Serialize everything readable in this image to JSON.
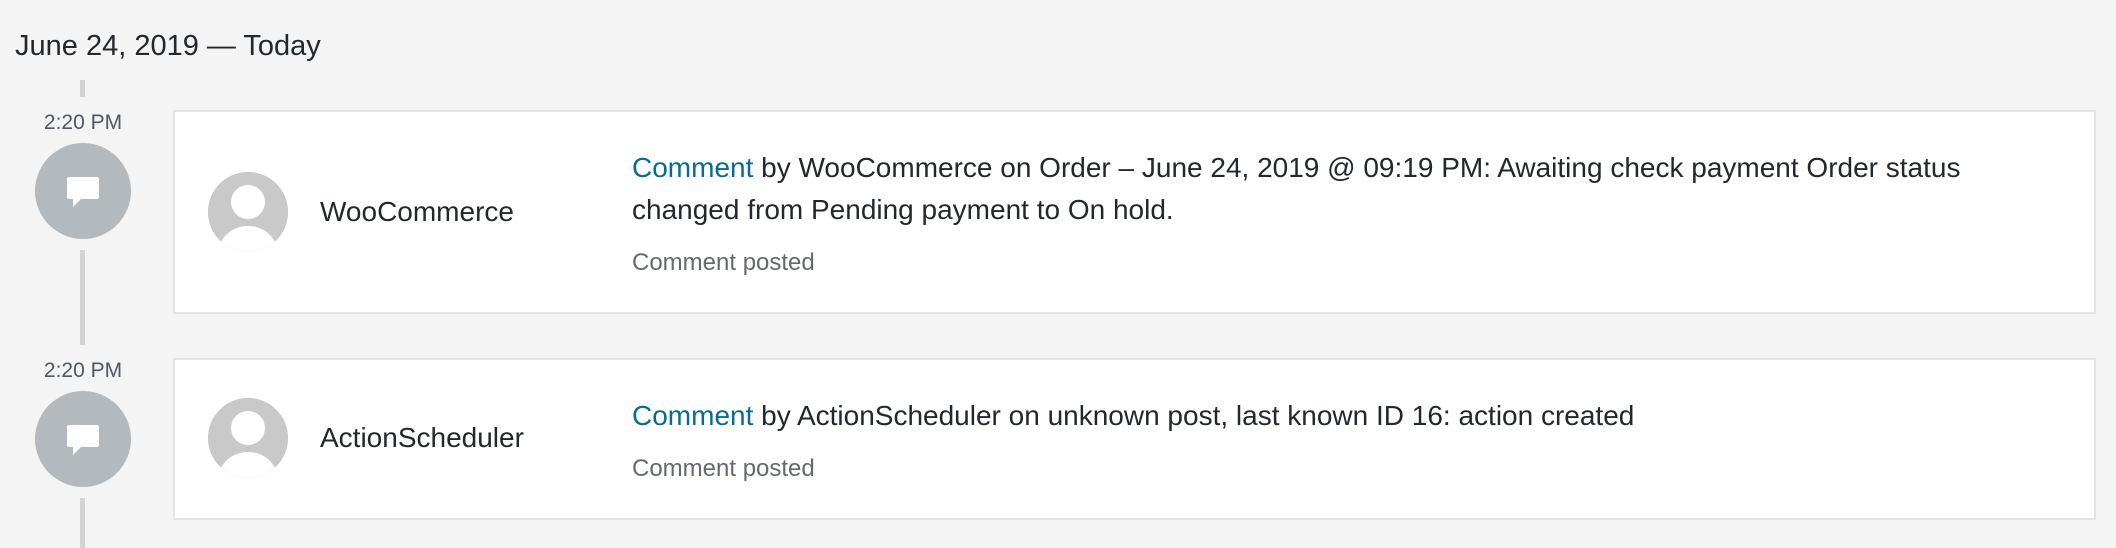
{
  "date_heading": "June 24, 2019 — Today",
  "entries": [
    {
      "time": "2:20 PM",
      "icon": "comment-icon",
      "author": "WooCommerce",
      "link_text": "Comment",
      "message": " by WooCommerce on Order – June 24, 2019 @ 09:19 PM: Awaiting check payment Order status changed from Pending payment to On hold.",
      "meta": "Comment posted"
    },
    {
      "time": "2:20 PM",
      "icon": "comment-icon",
      "author": "ActionScheduler",
      "link_text": "Comment",
      "message": " by ActionScheduler on unknown post, last known ID 16: action created",
      "meta": "Comment posted"
    }
  ],
  "colors": {
    "background": "#f4f4f4",
    "link": "#0a6a8f",
    "marker": "#b3b9bd",
    "timeline": "#d3d3d3"
  }
}
